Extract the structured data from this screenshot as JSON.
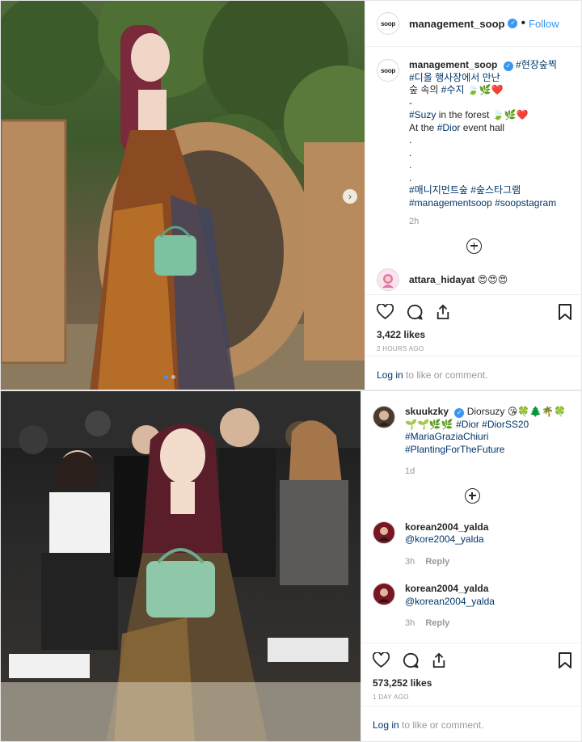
{
  "post1": {
    "header": {
      "username": "management_soop",
      "follow_label": "Follow",
      "separator": "•",
      "avatar_text": "soop"
    },
    "caption": {
      "username": "management_soop",
      "line1_tag": "#현장숲찍",
      "line2": "#디올 행사장에서 만난",
      "line3_pre": "숲 속의 ",
      "line3_tag": "#수지",
      "line3_emoji": "🍃🌿❤️",
      "line4": "-",
      "line5_tag": "#Suzy",
      "line5_text": " in the forest ",
      "line5_emoji": "🍃🌿❤️",
      "line6_pre": "At the ",
      "line6_tag": "#Dior",
      "line6_post": " event hall",
      "dots": [
        ".",
        ".",
        ".",
        "."
      ],
      "line7": "#매니지먼트숲 #숲스타그램",
      "line8": "#managementsoop #soopstagram",
      "time": "2h"
    },
    "comment": {
      "username": "attara_hidayat",
      "text": "😍😍😍"
    },
    "likes": "3,422 likes",
    "posted_ago": "2 HOURS AGO",
    "login": {
      "link": "Log in",
      "text": " to like or comment."
    },
    "icons": [
      "heart-icon",
      "comment-icon",
      "share-icon",
      "bookmark-icon"
    ],
    "photo_alt": "Woman in long floral dress holding mint handbag in front of large wooden letters in a forest"
  },
  "post2": {
    "caption": {
      "username": "skuukzky",
      "text1": "Diorsuzy ",
      "emoji1": "😘🍀🌲🌴🍀",
      "emoji2": "🌱🌱🌿🌿 ",
      "tag1": "#Dior",
      "tag2": "#DiorSS20",
      "tag3": "#MariaGraziaChiuri",
      "tag4": "#PlantingForTheFuture",
      "time": "1d"
    },
    "comments": [
      {
        "username": "korean2004_yalda",
        "mention": "@kore2004_yalda",
        "time": "3h",
        "reply": "Reply"
      },
      {
        "username": "korean2004_yalda",
        "mention": "@korean2004_yalda",
        "time": "3h",
        "reply": "Reply"
      }
    ],
    "likes": "573,252 likes",
    "posted_ago": "1 DAY AGO",
    "login": {
      "link": "Log in",
      "text": " to like or comment."
    },
    "photo_alt": "Woman seated at fashion show front row holding mint green handbag"
  },
  "colors": {
    "link": "#003569",
    "accent": "#3897f0",
    "muted": "#999999"
  }
}
